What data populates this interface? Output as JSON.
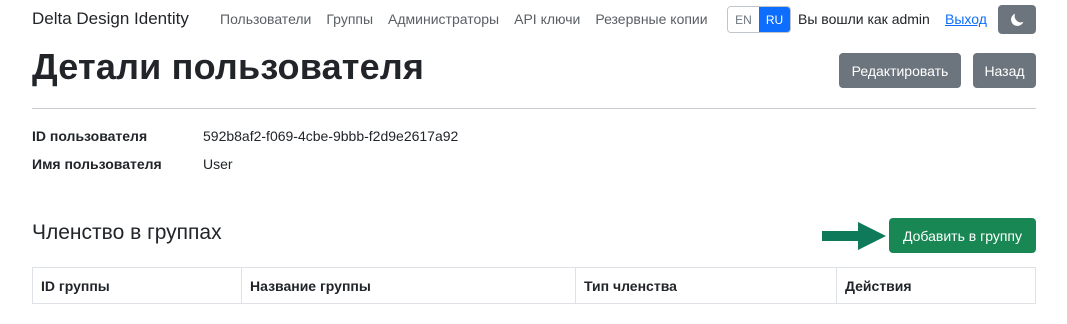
{
  "navbar": {
    "brand": "Delta Design Identity",
    "links": [
      "Пользователи",
      "Группы",
      "Администраторы",
      "API ключи",
      "Резервные копии"
    ],
    "lang_en": "EN",
    "lang_ru": "RU",
    "logged_in": "Вы вошли как admin",
    "logout": "Выход",
    "theme_icon": "moon-icon"
  },
  "header": {
    "title": "Детали пользователя",
    "edit_label": "Редактировать",
    "back_label": "Назад"
  },
  "details": {
    "id_label": "ID пользователя",
    "id_value": "592b8af2-f069-4cbe-9bbb-f2d9e2617a92",
    "name_label": "Имя пользователя",
    "name_value": "User"
  },
  "groups": {
    "title": "Членство в группах",
    "add_label": "Добавить в группу",
    "columns": [
      "ID группы",
      "Название группы",
      "Тип членства",
      "Действия"
    ]
  },
  "colors": {
    "primary": "#0d6efd",
    "secondary": "#6c757d",
    "success": "#198754",
    "arrow": "#0f7a5a"
  }
}
